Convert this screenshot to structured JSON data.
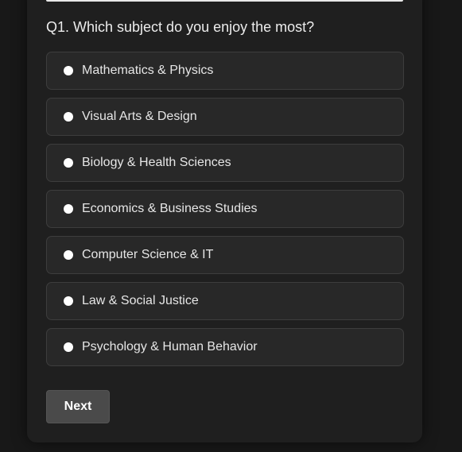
{
  "quiz": {
    "question": "Q1. Which subject do you enjoy the most?",
    "options": [
      {
        "label": "Mathematics & Physics"
      },
      {
        "label": "Visual Arts & Design"
      },
      {
        "label": "Biology & Health Sciences"
      },
      {
        "label": "Economics & Business Studies"
      },
      {
        "label": "Computer Science & IT"
      },
      {
        "label": "Law & Social Justice"
      },
      {
        "label": "Psychology & Human Behavior"
      }
    ],
    "next_label": "Next"
  },
  "colors": {
    "background": "#181818",
    "card": "#1f1f1f",
    "option_bg": "#282828",
    "option_border": "#3d3d3d",
    "button_bg": "#4a4a4a",
    "text": "#ececec"
  }
}
